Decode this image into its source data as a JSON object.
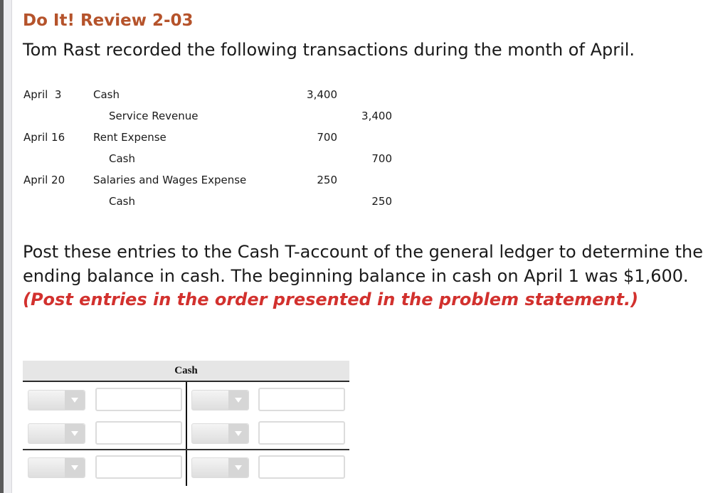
{
  "header": {
    "title": "Do It! Review 2-03",
    "intro": "Tom Rast recorded the following transactions during the month of April."
  },
  "journal": {
    "rows": [
      {
        "date": "April  3",
        "account": "Cash",
        "indent": false,
        "debit": "3,400",
        "credit": ""
      },
      {
        "date": "",
        "account": "Service Revenue",
        "indent": true,
        "debit": "",
        "credit": "3,400"
      },
      {
        "date": "April 16",
        "account": "Rent Expense",
        "indent": false,
        "debit": "700",
        "credit": ""
      },
      {
        "date": "",
        "account": "Cash",
        "indent": true,
        "debit": "",
        "credit": "700"
      },
      {
        "date": "April 20",
        "account": "Salaries and Wages Expense",
        "indent": false,
        "debit": "250",
        "credit": ""
      },
      {
        "date": "",
        "account": "Cash",
        "indent": true,
        "debit": "",
        "credit": "250"
      }
    ]
  },
  "instructions": {
    "text": "Post these entries to the Cash T-account of the general ledger to determine the ending balance in cash. The beginning balance in cash on April 1 was $1,600.",
    "emphasis": "(Post entries in the order presented in the problem statement.)"
  },
  "t_account": {
    "title": "Cash",
    "debit_side": [
      {
        "select_value": "",
        "amount_value": "",
        "amount_placeholder": ""
      },
      {
        "select_value": "",
        "amount_value": "",
        "amount_placeholder": ""
      },
      {
        "select_value": "",
        "amount_value": "",
        "amount_placeholder": ""
      }
    ],
    "credit_side": [
      {
        "select_value": "",
        "amount_value": "",
        "amount_placeholder": ""
      },
      {
        "select_value": "",
        "amount_value": "",
        "amount_placeholder": ""
      },
      {
        "select_value": "",
        "amount_value": "",
        "amount_placeholder": ""
      }
    ]
  },
  "colors": {
    "title": "#b5532b",
    "emphasis": "#d2312e",
    "t_header_bg": "#e6e6e6"
  }
}
